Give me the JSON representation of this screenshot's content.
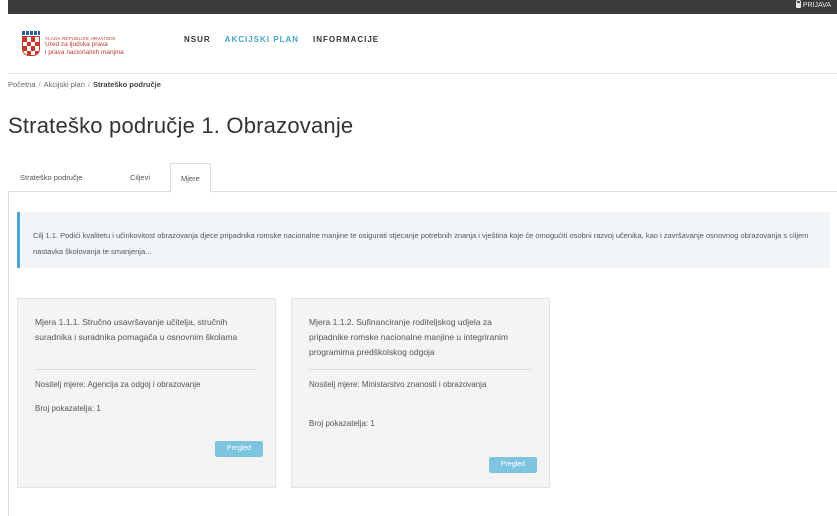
{
  "topbar": {
    "login_label": "PRIJAVA"
  },
  "logo": {
    "line1": "VLADA REPUBLIKE HRVATSKE",
    "line2": "Ured za ljudska prava",
    "line3": "i prava nacionalnih manjina"
  },
  "nav": {
    "items": [
      {
        "label": "NSUR"
      },
      {
        "label": "AKCIJSKI PLAN"
      },
      {
        "label": "INFORMACIJE"
      }
    ]
  },
  "breadcrumb": {
    "items": [
      "Početna",
      "Akcijski plan",
      "Strateško područje"
    ],
    "separator": "/"
  },
  "page_title": "Strateško područje 1. Obrazovanje",
  "tabs": [
    {
      "label": "Strateško područje"
    },
    {
      "label": "Ciljevi"
    },
    {
      "label": "Mjere"
    }
  ],
  "goal": {
    "text": "Cilj 1.1. Podići kvalitetu i učinkovitost obrazovanja djece pripadnika romske nacionalne manjine te osigurati stjecanje potrebnih znanja i vještina koje će omogućiti osobni razvoj učenika, kao i završavanje osnovnog obrazovanja s ciljem nastavka školovanja te smanjenja..."
  },
  "cards": [
    {
      "title": "Mjera 1.1.1. Stručno usavršavanje učitelja, stručnih suradnika i suradnika pomagača u osnovnim školama",
      "holder": "Nositelj mjere: Agencija za odgoj i obrazovanje",
      "indicators": "Broj pokazatelja: 1",
      "button": "Pregled"
    },
    {
      "title": "Mjera 1.1.2. Sufinanciranje roditeljskog udjela za pripadnike romske nacionalne manjine u integriranim programima predškolskog odgoja",
      "holder": "Nositelj mjere: Ministarstvo znanosti i obrazovanja",
      "indicators": "Broj pokazatelja: 1",
      "button": "Pregled"
    }
  ],
  "colors": {
    "accent": "#3fa7c7",
    "button": "#7cc4e0",
    "topbar": "#3b3b3b"
  }
}
